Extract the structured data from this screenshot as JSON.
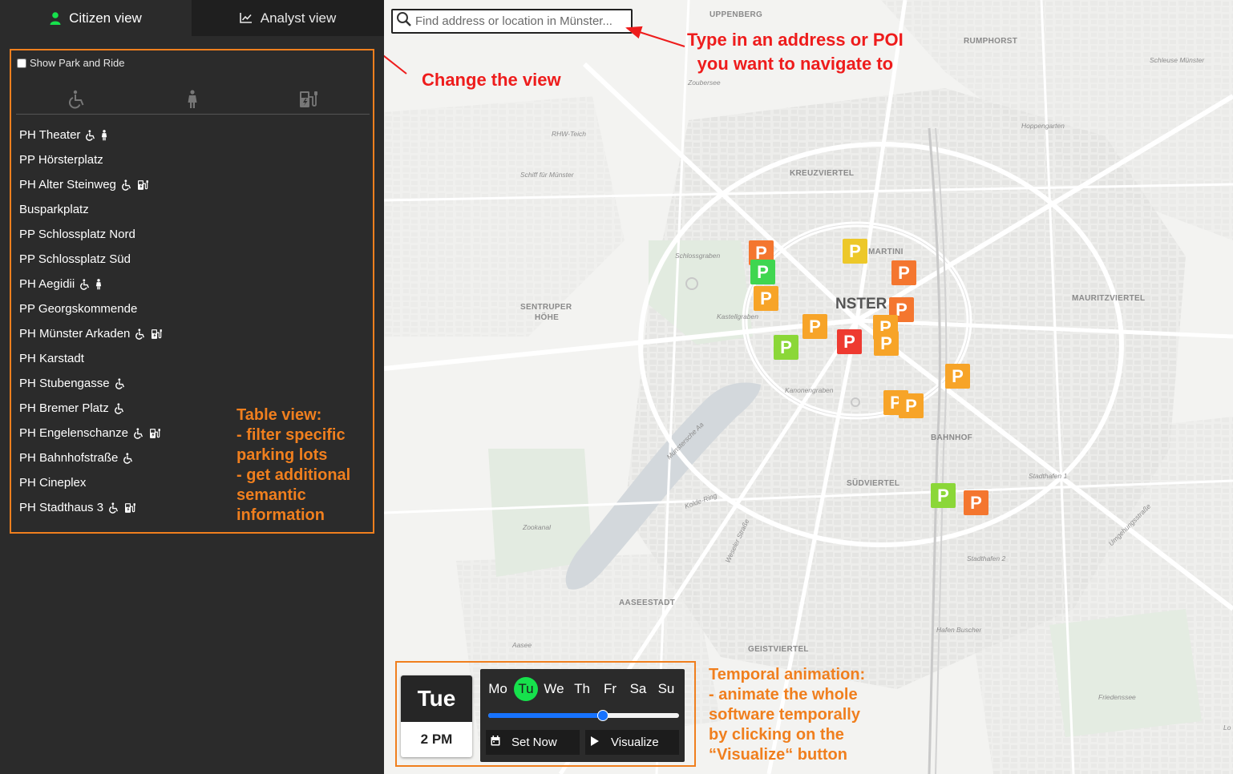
{
  "tabs": {
    "citizen": "Citizen view",
    "analyst": "Analyst view"
  },
  "panel": {
    "park_ride_label": "Show Park and Ride",
    "filters": [
      "wheelchair-icon",
      "woman-icon",
      "ev-charging-icon"
    ],
    "lots": [
      {
        "name": "PH Theater",
        "icons": [
          "wheelchair",
          "woman"
        ]
      },
      {
        "name": "PP Hörsterplatz",
        "icons": []
      },
      {
        "name": "PH Alter Steinweg",
        "icons": [
          "wheelchair",
          "ev"
        ]
      },
      {
        "name": "Busparkplatz",
        "icons": []
      },
      {
        "name": "PP Schlossplatz Nord",
        "icons": []
      },
      {
        "name": "PP Schlossplatz Süd",
        "icons": []
      },
      {
        "name": "PH Aegidii",
        "icons": [
          "wheelchair",
          "woman"
        ]
      },
      {
        "name": "PP Georgskommende",
        "icons": []
      },
      {
        "name": "PH Münster Arkaden",
        "icons": [
          "wheelchair",
          "ev"
        ]
      },
      {
        "name": "PH Karstadt",
        "icons": []
      },
      {
        "name": "PH Stubengasse",
        "icons": [
          "wheelchair"
        ]
      },
      {
        "name": "PH Bremer Platz",
        "icons": [
          "wheelchair"
        ]
      },
      {
        "name": "PH Engelenschanze",
        "icons": [
          "wheelchair",
          "ev"
        ]
      },
      {
        "name": "PH Bahnhofstraße",
        "icons": [
          "wheelchair"
        ]
      },
      {
        "name": "PH Cineplex",
        "icons": []
      },
      {
        "name": "PH Stadthaus 3",
        "icons": [
          "wheelchair",
          "ev"
        ]
      }
    ],
    "annotation": [
      "Table view:",
      "- filter specific",
      "parking lots",
      "- get additional",
      "semantic",
      "information"
    ]
  },
  "map": {
    "search_placeholder": "Find address or location in Münster...",
    "districts": [
      "UPPENBERG",
      "RUMPHORST",
      "KREUZVIERTEL",
      "MARTINI",
      "MAURITZVIERTEL",
      "SENTRUPER",
      "HÖHE",
      "BAHNHOF",
      "SÜDVIERTEL",
      "AASEESTADT",
      "GEISTVIERTEL"
    ],
    "streets": [
      "Zoubersee",
      "RHW-Teich",
      "Schiff für Münster",
      "Schlossgraben",
      "Kastellgraben",
      "Kanonengraben",
      "Munstersche Aa",
      "Kolde-Ring",
      "Zookanal",
      "Weseler Straße",
      "Hoppengarten",
      "Schleuse Münster",
      "Stadthafen 1",
      "Stadthafen 2",
      "Umgehungsstraße",
      "Hafen Buscher",
      "Friedenssee",
      "Aasee",
      "Lo"
    ],
    "city": "NSTER",
    "marker_letter": "P",
    "markers": [
      {
        "color": "#f4762f"
      },
      {
        "color": "#3fd650"
      },
      {
        "color": "#f7a428"
      },
      {
        "color": "#edc829"
      },
      {
        "color": "#f4762f"
      },
      {
        "color": "#f4762f"
      },
      {
        "color": "#f7a428"
      },
      {
        "color": "#8bd738"
      },
      {
        "color": "#ee3a30"
      },
      {
        "color": "#f7a428"
      },
      {
        "color": "#f7a428"
      },
      {
        "color": "#f7a428"
      },
      {
        "color": "#f7a428"
      },
      {
        "color": "#f7a428"
      },
      {
        "color": "#8bd738"
      },
      {
        "color": "#f4762f"
      }
    ],
    "annotation_search": [
      "Type in an address or POI",
      "you want to navigate to"
    ],
    "annotation_view": "Change the view",
    "annotation_temporal": [
      "Temporal animation:",
      "- animate the whole",
      "software temporally",
      "by clicking on the",
      "“Visualize“ button"
    ]
  },
  "time": {
    "day_short": "Tue",
    "hour": "2 PM",
    "days": [
      "Mo",
      "Tu",
      "We",
      "Th",
      "Fr",
      "Sa",
      "Su"
    ],
    "selected_day": "Tu",
    "slider_fraction": 0.6,
    "set_now_label": "Set Now",
    "visualize_label": "Visualize"
  },
  "colors": {
    "accent_green": "#16e14c",
    "slider_blue": "#1773ff",
    "annotation_red": "#ee1c1c",
    "annotation_orange": "#f07f1e"
  }
}
